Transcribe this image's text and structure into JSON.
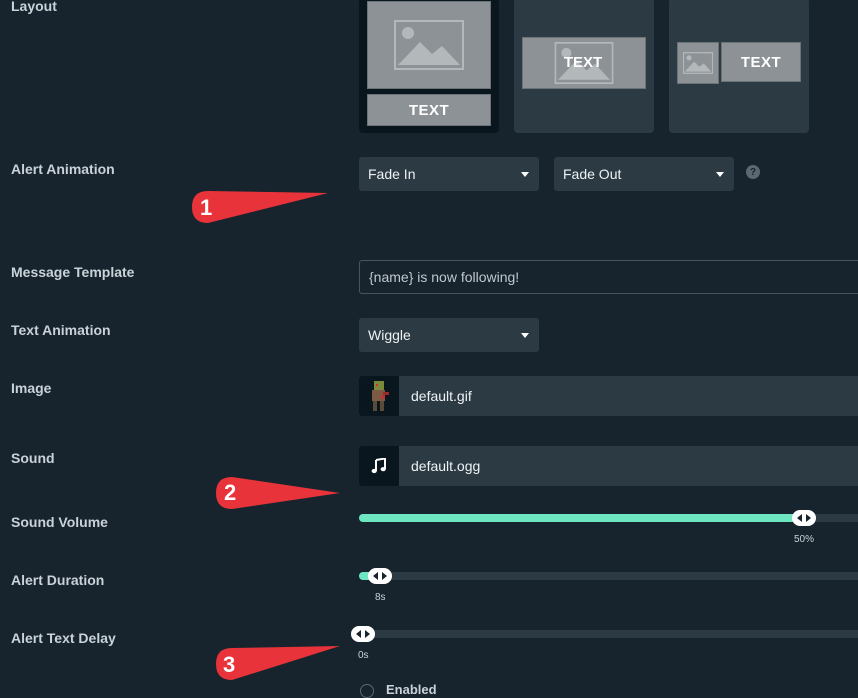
{
  "labels": {
    "layout": "Layout",
    "alert_animation": "Alert Animation",
    "message_template": "Message Template",
    "text_animation": "Text Animation",
    "image": "Image",
    "sound": "Sound",
    "sound_volume": "Sound Volume",
    "alert_duration": "Alert Duration",
    "alert_text_delay": "Alert Text Delay"
  },
  "layout_options": [
    {
      "text": "TEXT",
      "selected": true
    },
    {
      "text": "TEXT",
      "selected": false
    },
    {
      "text": "TEXT",
      "selected": false
    }
  ],
  "alert_animation": {
    "in": "Fade In",
    "out": "Fade Out",
    "help": "?"
  },
  "message_template": {
    "value": "{name} is now following!"
  },
  "text_animation": {
    "value": "Wiggle"
  },
  "image": {
    "filename": "default.gif"
  },
  "sound": {
    "filename": "default.ogg"
  },
  "sliders": {
    "volume": {
      "value_label": "50%",
      "fraction": 0.5
    },
    "duration": {
      "value_label": "8s",
      "fraction": 0.04
    },
    "text_delay": {
      "value_label": "0s",
      "fraction": 0
    }
  },
  "enabled_label": "Enabled",
  "annotations": [
    "1",
    "2",
    "3"
  ],
  "colors": {
    "accent": "#6ee7c0",
    "annotation": "#e8333a",
    "background": "#17242d",
    "control": "#2b3a43"
  }
}
